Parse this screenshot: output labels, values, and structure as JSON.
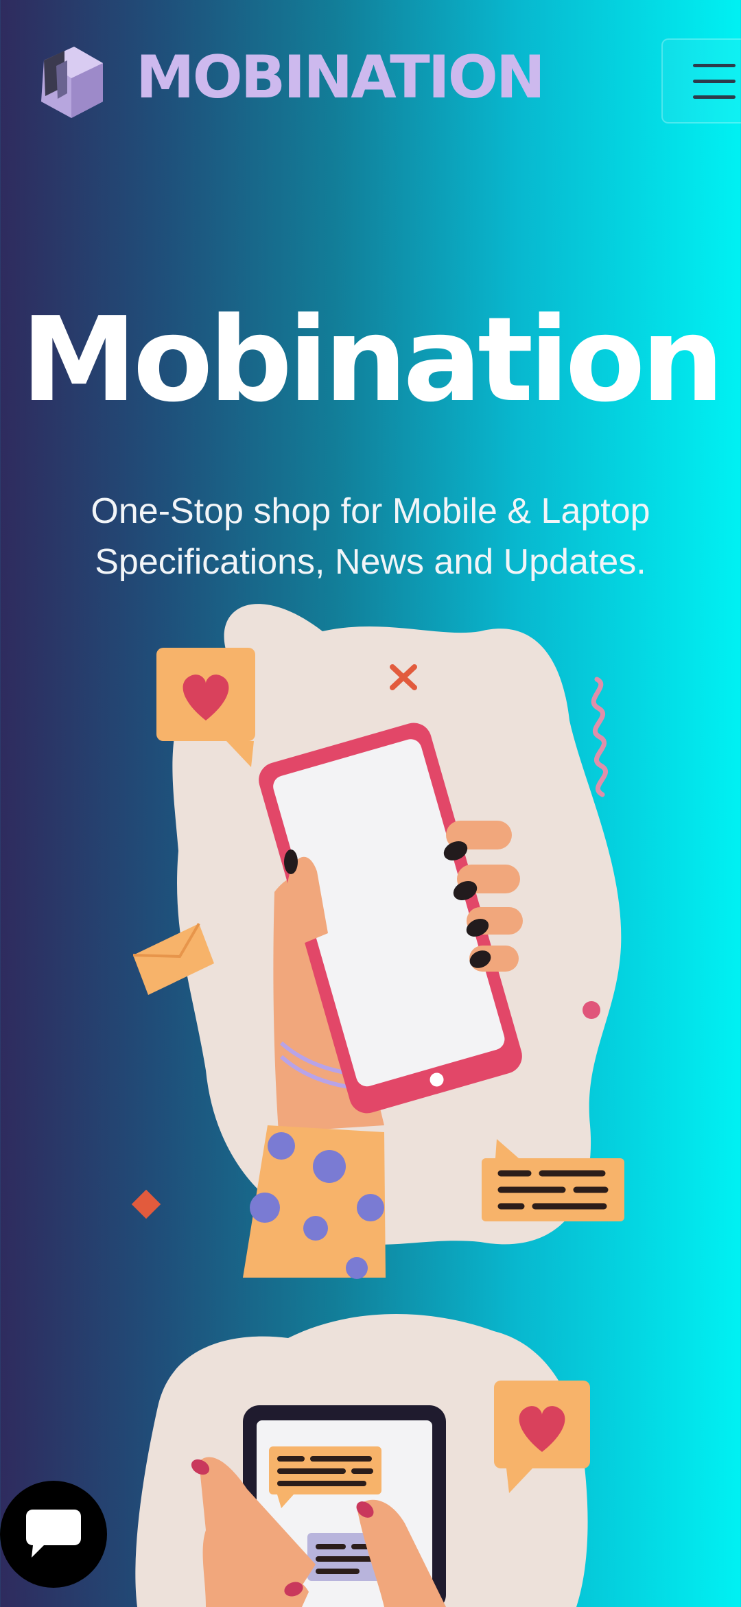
{
  "header": {
    "brand_name": "MOBINATION",
    "logo_icon": "cube-logo-icon",
    "menu_icon": "hamburger-menu-icon"
  },
  "hero": {
    "title": "Mobination",
    "tagline_line1": "One-Stop shop for Mobile & Laptop",
    "tagline_line2": "Specifications, News and Updates."
  },
  "illustrations": [
    {
      "name": "hand-holding-phone-illustration"
    },
    {
      "name": "hand-holding-tablet-illustration"
    }
  ],
  "chat_button": {
    "icon": "chat-bubble-icon"
  },
  "colors": {
    "gradient_left": "#2f2b5e",
    "gradient_right": "#00f1f3",
    "brand_text": "#cdb9ee",
    "phone_frame": "#e24768",
    "blob": "#ede1da",
    "bubble_orange": "#f7b36a",
    "heart": "#d9415c"
  }
}
